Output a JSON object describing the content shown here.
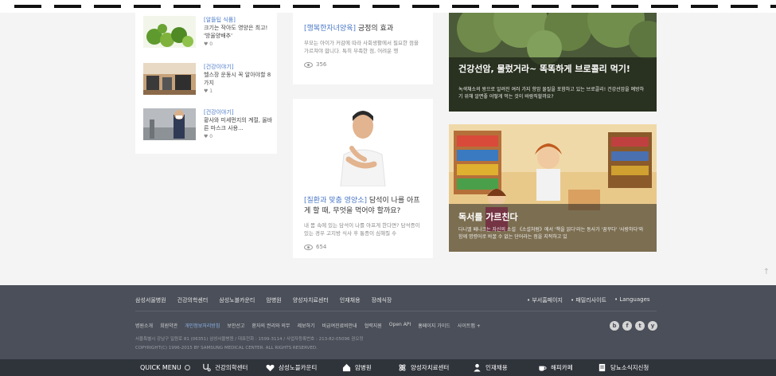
{
  "list_card": {
    "items": [
      {
        "category": "[알뜰팁 식품]",
        "title": "크기는 작아도 영양은 최고! '방울양배추'",
        "likes": "0"
      },
      {
        "category": "[건강이야기]",
        "title": "헬스장 운동시 꼭 알아야할 8가지",
        "likes": "1"
      },
      {
        "category": "[건강이야기]",
        "title": "황사와 미세먼지의 계절, 올바른 마스크 사용...",
        "likes": "0"
      }
    ]
  },
  "mid_cards": [
    {
      "category": "[행복한자녀양육]",
      "title": " 긍정의 효과",
      "desc": "부모는 아이가 커감에 따라 사회생활에서 필요한 점을 가르쳐야 합니다. 특히 부족한 점, 어려운 행",
      "views": "356"
    },
    {
      "category": "[질환과 맞춤 영양소]",
      "title": " 담석이 나를 아프게 할 때, 무엇을 먹어야 할까요?",
      "desc": "내 몸 속에 있는 담석이 나를 아프게 한다면? 담석증이 있는 경우 고지방 식사 후 통증이 심해질 수",
      "views": "654"
    }
  ],
  "img_cards": [
    {
      "title": "건강선암, 물렀거라~ 똑똑하게 브로콜리 먹기!",
      "desc": "녹색채소의 왕으로 알려진 여러 가지 항암 물질을 포함하고 있는 브로콜리! 건강선암을 예방하기 위해 알면좋 어떻게 먹는 것이 바람직할까요?"
    },
    {
      "title": "독서를 가르친다",
      "desc": "다니엘 페나크는 자신의 소설 《소설처럼》에서 '책을 읽다'라는 동사가 '꿈꾸다' '사랑하다'와 함께 명령어로 바꿀 수 없는 단어라는 점을 지적하고 있"
    }
  ],
  "to_top": "↑",
  "footer": {
    "links": [
      "삼성서울병원",
      "건강의학센터",
      "삼성노블카운티",
      "암병원",
      "양성자치료센터",
      "인재채용",
      "장례식장"
    ],
    "right_links": [
      "• 부서홈페이지",
      "• 패밀리사이트",
      "• Languages"
    ],
    "links2": [
      "병원소개",
      "회원약관",
      "개인정보처리방침",
      "보안선고",
      "환자의 권리와 의무",
      "제보하기",
      "비급여진료비안내",
      "협력지원",
      "Open API",
      "홈페이지 가이드",
      "사이트맵 +"
    ],
    "address": "서울특별시 강남구 일원로 81 (06351) 삼성서울병원 / 대표전화 : 1599-3114 / 사업자등록번호 : 213-82-05096 권오정",
    "copyright": "COPYRIGHT(C) 1996-2015 BY SAMSUNG MEDICAL CENTER. ALL RIGHTS RESERVED.",
    "social": [
      "b",
      "f",
      "t",
      "y"
    ]
  },
  "quick_menu": {
    "label": "QUICK MENU",
    "items": [
      "건강의학센터",
      "삼성노블카운티",
      "암병원",
      "양성자치료센터",
      "인재채용",
      "해피카페",
      "당뇨소식지신청"
    ]
  },
  "colors": {
    "accent": "#4a78c8",
    "footer_bg": "#4a4f59",
    "quickmenu_bg": "#2f333a"
  }
}
